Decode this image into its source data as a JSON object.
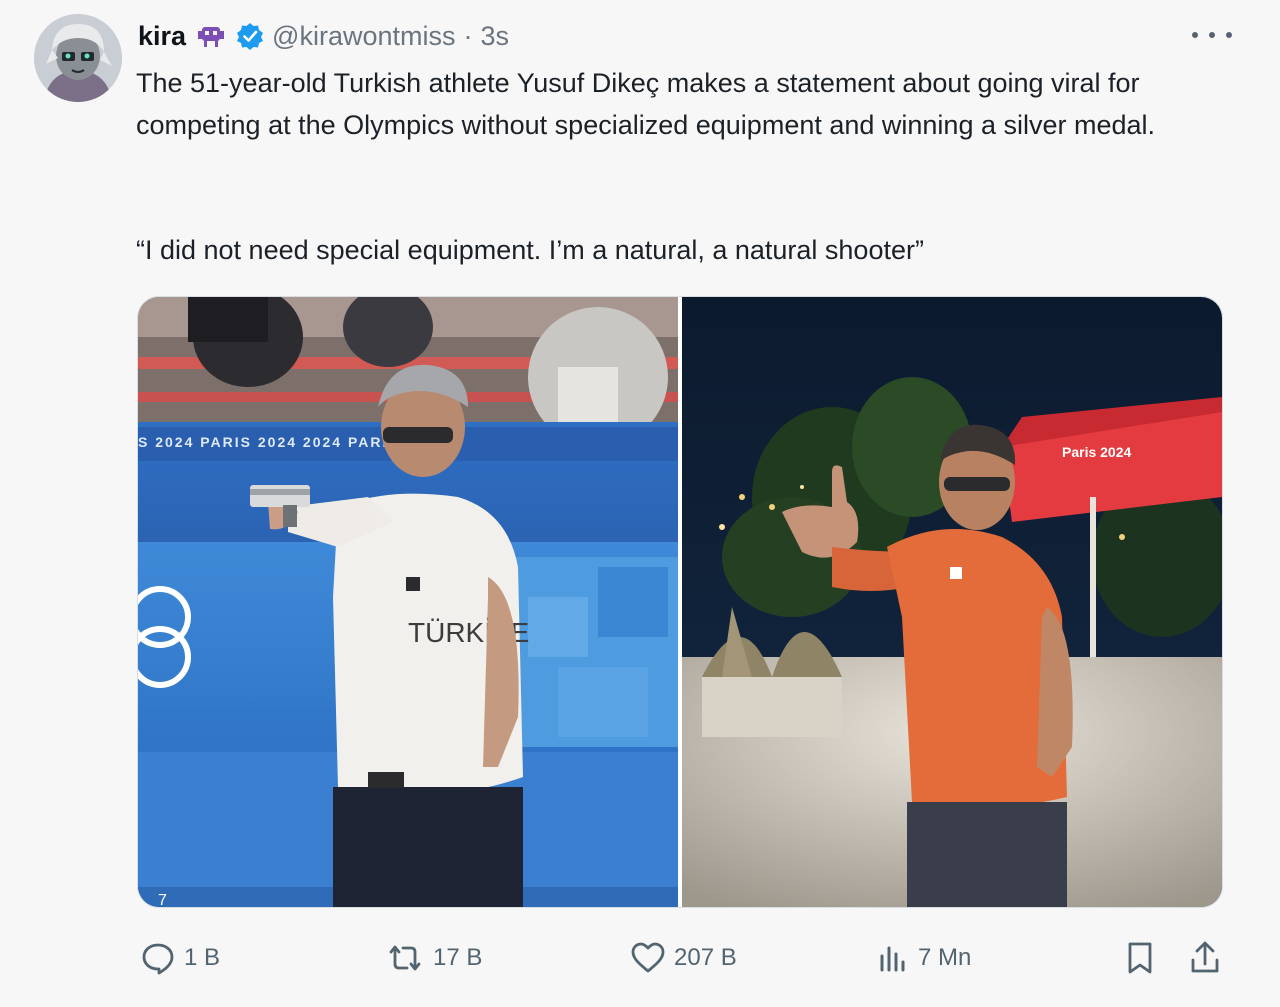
{
  "author": {
    "name": "kira",
    "handle": "@kirawontmiss",
    "separator": "·",
    "time": "3s"
  },
  "tweet": {
    "text": "The 51-year-old Turkish athlete Yusuf Dikeç makes a statement about going viral for competing at the Olympics without specialized equipment and winning a silver medal.",
    "quote": "“I did not need special equipment. I’m a natural, a natural shooter”"
  },
  "media": {
    "left_photo": {
      "banner_text": "S 2024   PARIS 2024   2024   PARIS 2024",
      "shirt_text": "TÜRKİYE",
      "corner_number": "7"
    },
    "right_photo": {
      "umbrella_text": "Paris 2024"
    }
  },
  "actions": {
    "replies": "1 B",
    "reposts": "17 B",
    "likes": "207 B",
    "views": "7 Mn"
  },
  "colors": {
    "accent_verified": "#1d9bf0",
    "text_secondary": "#536471",
    "background": "#f7f7f7"
  },
  "icons": [
    "more-icon",
    "verified-icon",
    "reply-icon",
    "repost-icon",
    "like-icon",
    "views-icon",
    "bookmark-icon",
    "share-icon"
  ]
}
